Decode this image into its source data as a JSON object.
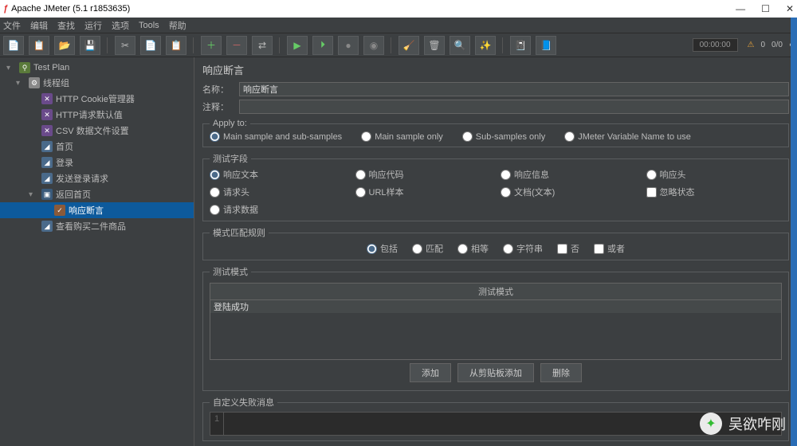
{
  "window": {
    "title": "Apache JMeter (5.1 r1853635)"
  },
  "menu": [
    "文件",
    "编辑",
    "查找",
    "运行",
    "选项",
    "Tools",
    "帮助"
  ],
  "timer": "00:00:00",
  "status": {
    "warn": "0",
    "total": "0/0"
  },
  "tree": {
    "root": {
      "label": "Test Plan"
    },
    "tg": {
      "label": "线程组"
    },
    "cookie": {
      "label": "HTTP Cookie管理器"
    },
    "defaults": {
      "label": "HTTP请求默认值"
    },
    "csv": {
      "label": "CSV 数据文件设置"
    },
    "home": {
      "label": "首页"
    },
    "login": {
      "label": "登录"
    },
    "sendlogin": {
      "label": "发送登录请求"
    },
    "back": {
      "label": "返回首页"
    },
    "assert": {
      "label": "响应断言"
    },
    "view": {
      "label": "查看购买二件商品"
    }
  },
  "panel": {
    "title": "响应断言",
    "name_label": "名称：",
    "name_value": "响应断言",
    "comment_label": "注释：",
    "apply_legend": "Apply to:",
    "apply": [
      "Main sample and sub-samples",
      "Main sample only",
      "Sub-samples only",
      "JMeter Variable Name to use"
    ],
    "field_legend": "测试字段",
    "fields": [
      "响应文本",
      "响应代码",
      "响应信息",
      "响应头",
      "请求头",
      "URL样本",
      "文档(文本)",
      "忽略状态",
      "请求数据"
    ],
    "rule_legend": "模式匹配规则",
    "rules": [
      "包括",
      "匹配",
      "相等",
      "字符串",
      "否",
      "或者"
    ],
    "pattern_legend": "测试模式",
    "pattern_header": "测试模式",
    "pattern_value": "登陆成功",
    "buttons": {
      "add": "添加",
      "paste": "从剪贴板添加",
      "delete": "删除"
    },
    "fail_legend": "自定义失败消息",
    "line_no": "1"
  },
  "watermark": "吴欲咋刚"
}
